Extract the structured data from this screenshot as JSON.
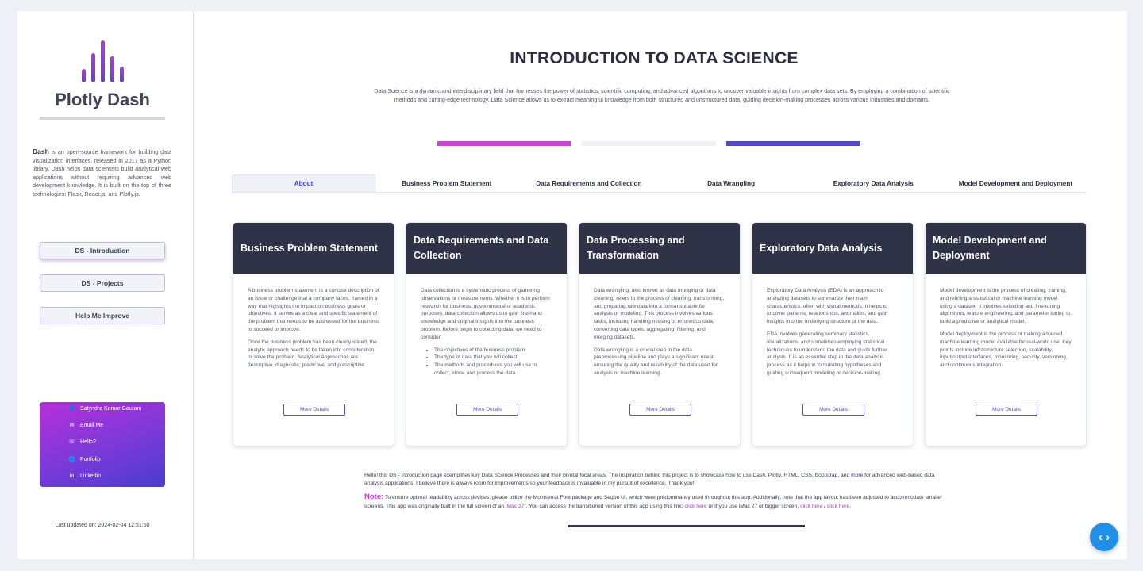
{
  "sidebar": {
    "logo_title": "Plotly Dash",
    "logo_bar_heights": [
      0.32,
      0.7,
      1.0,
      0.62,
      0.38
    ],
    "description_lead": "Dash",
    "description_rest": " is an open-source framework for building data visualization interfaces, released in 2017 as a Python library. Dash helps data scientists build analytical web applications without requiring advanced web development knowledge. It is built on the top of three technologies: Flask, React.js, and Plotly.js.",
    "buttons": [
      {
        "label": "DS - Introduction",
        "active": true
      },
      {
        "label": "DS - Projects",
        "active": false
      },
      {
        "label": "Help Me Improve",
        "active": false
      }
    ],
    "contact": [
      {
        "icon": "person-icon",
        "glyph": "👤",
        "label": "Satyndra Kumar Gautam"
      },
      {
        "icon": "mail-icon",
        "glyph": "✉",
        "label": "Email Me"
      },
      {
        "icon": "whatsapp-icon",
        "glyph": "☏",
        "label": "Hello?"
      },
      {
        "icon": "globe-icon",
        "glyph": "🌐",
        "label": "Portfolio"
      },
      {
        "icon": "linkedin-icon",
        "glyph": "in",
        "label": "Linkedin"
      }
    ],
    "updated": "Last updated on: 2024-02-04 12:51:50"
  },
  "header": {
    "title": "INTRODUCTION TO DATA SCIENCE",
    "intro": "Data Science is a dynamic and interdisciplinary field that harnesses the power of statistics, scientific computing, and advanced algorithms to uncover valuable insights from complex data sets. By employing a combination of scientific methods and cutting-edge technology, Data Science allows us to extract meaningful knowledge from both structured and unstructured data, guiding decision-making processes across various industries and domains."
  },
  "colors": {
    "bar1": "#d93ad9",
    "bar2": "#eff1f6",
    "bar3": "#5146d3"
  },
  "tabs": [
    {
      "label": "About",
      "active": true
    },
    {
      "label": "Business Problem Statement",
      "active": false
    },
    {
      "label": "Data Requirements and Collection",
      "active": false
    },
    {
      "label": "Data Wrangling",
      "active": false
    },
    {
      "label": "Exploratory Data Analysis",
      "active": false
    },
    {
      "label": "Model Development and Deployment",
      "active": false
    }
  ],
  "cards": [
    {
      "title": "Business Problem Statement",
      "p1": "A business problem statement is a concise description of an issue or challenge that a company faces, framed in a way that highlights the impact on business goals or objectives. It serves as a clear and specific statement of the problem that needs to be addressed for the business to succeed or improve.",
      "p2": "Once the business problem has been clearly stated, the analytic approach needs to be taken into consideration to solve the problem. Analytical Approaches are descriptive, diagnostic, predictive, and prescriptive.",
      "button": "More Details"
    },
    {
      "title": "Data Requirements and Data Collection",
      "p1": "Data collection is a systematic process of gathering observations or measurements. Whether it is to perform research for business, governmental or academic purposes, data collection allows us to gain first-hand knowledge and original insights into the business problem. Before begin to collecting data, we need to consider:",
      "list": [
        "The objectives of the business problem",
        "The type of data that you will collect",
        "The methods and procedures you will use to collect, store, and process the data"
      ],
      "button": "More Details"
    },
    {
      "title": "Data Processing and Transformation",
      "p1": "Data wrangling, also known as data munging or data cleaning, refers to the process of cleaning, transforming, and preparing raw data into a format suitable for analysis or modeling. This process involves various tasks, including handling missing or erroneous data, converting data types, aggregating, filtering, and merging datasets.",
      "p2": "Data wrangling is a crucial step in the data preprocessing pipeline and plays a significant role in ensuring the quality and reliability of the data used for analysis or machine learning.",
      "button": "More Details"
    },
    {
      "title": "Exploratory Data Analysis",
      "p1": "Exploratory Data Analysis (EDA) is an approach to analyzing datasets to summarize their main characteristics, often with visual methods. It helps to uncover patterns, relationships, anomalies, and gain insights into the underlying structure of the data.",
      "p2": "EDA involves generating summary statistics, visualizations, and sometimes employing statistical techniques to understand the data and guide further analysis. It is an essential step in the data analysis process as it helps in formulating hypotheses and guiding subsequent modeling or decision-making.",
      "button": "More Details"
    },
    {
      "title": "Model Development and Deployment",
      "p1": "Model development is the process of creating, training, and refining a statistical or machine learning model using a dataset. It involves selecting and fine-tuning algorithms, feature engineering, and parameter tuning to build a predictive or analytical model.",
      "p2": "Model deployment is the process of making a trained machine learning model available for real-world use. Key points include infrastructure selection, scalability, input/output interfaces, monitoring, security, versioning, and continuous integration.",
      "button": "More Details"
    }
  ],
  "footer": {
    "text": "Hello! this DS - Introduction page exemplifies key Data Science Processes and their pivotal focal areas. The inspiration behind this project is to showcase how to use Dash, Plotly, HTML, CSS, Bootstrap, and more for advanced web-based data analysis applications. I believe there is always room for improvements so your feedback is invaluable in my pursuit of excellence. Thank you!",
    "note_label": "Note:",
    "note_a": " To ensure optimal readability across devices, please utilize the Montserrat Font package and Segoe UI, which were predominantly used throughout this app. Additionally, note that the app layout has been adjusted to accommodate smaller screens. This app was originally built in the full screen of an ",
    "note_imac": "iMac 27\"",
    "note_b": ". You can access the transitioned version of this app using this link: ",
    "note_link1": "click here",
    "note_c": " or if you use iMac 27 or bigger screen, ",
    "note_link2": "click here",
    "note_sep": " / ",
    "note_link3": "click here",
    "note_end": "."
  },
  "fab": {
    "icon": "code-icon",
    "glyph": "‹ ›"
  }
}
